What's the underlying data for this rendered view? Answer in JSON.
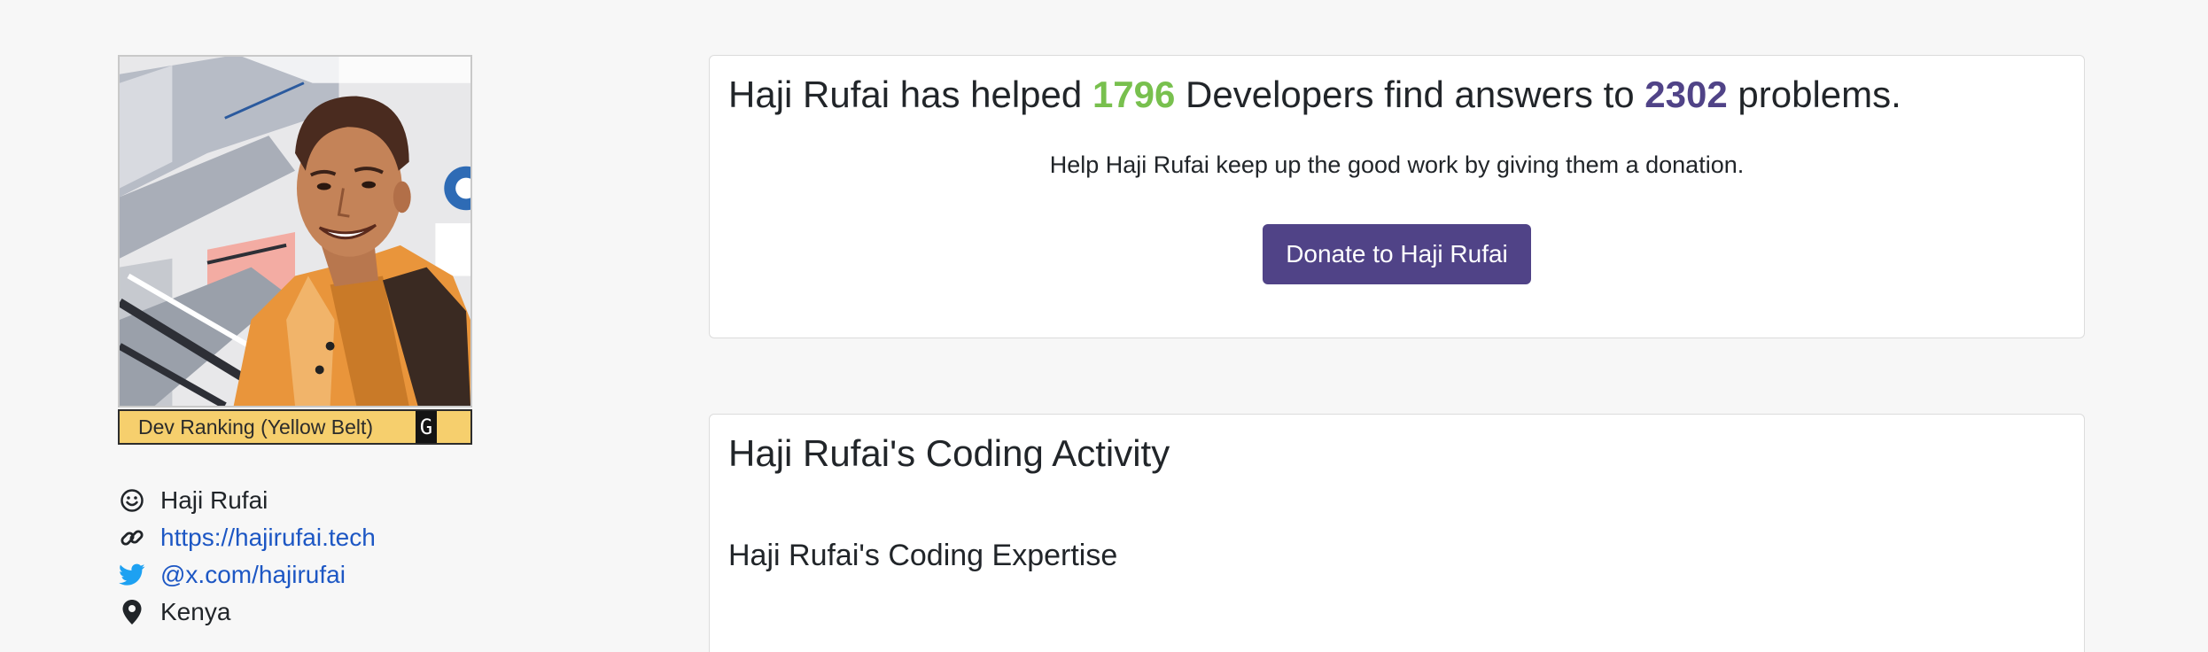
{
  "profile": {
    "rank_label": "Dev Ranking (Yellow Belt)",
    "rank_grade": "G",
    "name": "Haji Rufai",
    "website": "https://hajirufai.tech",
    "twitter": "@x.com/hajirufai",
    "location": "Kenya",
    "belt_color": "#f6cf6d"
  },
  "stats": {
    "name": "Haji Rufai",
    "text1": " has helped ",
    "developers": "1796",
    "text2": " Developers find answers to ",
    "problems": "2302",
    "text3": " problems."
  },
  "donation": {
    "help_text": "Help Haji Rufai keep up the good work by giving them a donation.",
    "button_label": "Donate to Haji Rufai"
  },
  "activity": {
    "title": "Haji Rufai's Coding Activity",
    "expertise_title": "Haji Rufai's Coding Expertise"
  },
  "colors": {
    "accent_purple": "#504387",
    "accent_green": "#78c04e",
    "link_blue": "#1d57c4",
    "twitter_blue": "#1da1f2"
  },
  "icons": {
    "name": "smiley-icon",
    "website": "link-icon",
    "twitter": "twitter-icon",
    "location": "map-pin-icon"
  }
}
